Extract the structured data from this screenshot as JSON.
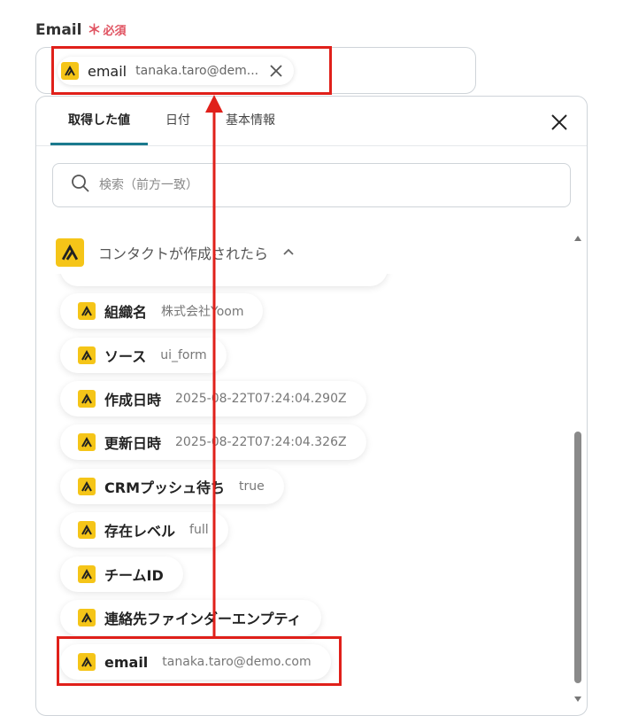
{
  "field": {
    "label": "Email",
    "required_mark": "＊",
    "required_text": "必須"
  },
  "selected_token": {
    "icon": "yoom-logo-icon",
    "name": "email",
    "value": "tanaka.taro@dem..."
  },
  "tabs": [
    {
      "label": "取得した値",
      "active": true
    },
    {
      "label": "日付",
      "active": false
    },
    {
      "label": "基本情報",
      "active": false
    }
  ],
  "search": {
    "placeholder": "検索（前方一致）",
    "value": ""
  },
  "group": {
    "icon": "yoom-logo-icon",
    "title": "コンタクトが作成されたら",
    "state": "expanded"
  },
  "items": [
    {
      "name": "組織名",
      "value": "株式会社Yoom"
    },
    {
      "name": "ソース",
      "value": "ui_form"
    },
    {
      "name": "作成日時",
      "value": "2025-08-22T07:24:04.290Z"
    },
    {
      "name": "更新日時",
      "value": "2025-08-22T07:24:04.326Z"
    },
    {
      "name": "CRMプッシュ待ち",
      "value": "true"
    },
    {
      "name": "存在レベル",
      "value": "full"
    },
    {
      "name": "チームID",
      "value": ""
    },
    {
      "name": "連絡先ファインダーエンプティ",
      "value": ""
    },
    {
      "name": "email",
      "value": "tanaka.taro@demo.com"
    }
  ],
  "colors": {
    "accent": "#1b7a8e",
    "required": "#e05260",
    "app_icon": "#f5c518",
    "annotation": "#e0201a"
  }
}
